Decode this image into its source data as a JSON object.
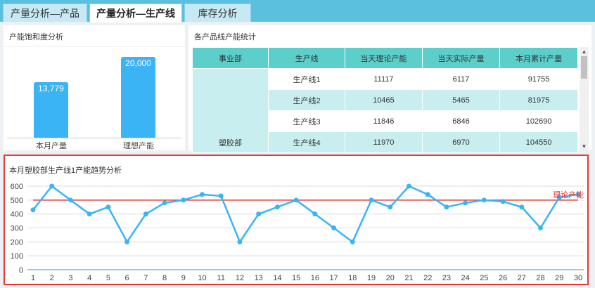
{
  "tabs": [
    {
      "label": "产量分析—产品"
    },
    {
      "label": "产量分析—生产线"
    },
    {
      "label": "库存分析"
    }
  ],
  "capacity": {
    "title": "产能饱和度分析",
    "bars": [
      {
        "label": "本月产量",
        "value": 13779,
        "display": "13,779"
      },
      {
        "label": "理想产能",
        "value": 20000,
        "display": "20,000"
      }
    ]
  },
  "stats": {
    "title": "各产品线产能统计",
    "columns": [
      "事业部",
      "生产线",
      "当天理论产能",
      "当天实际产量",
      "本月累计产量"
    ],
    "dept": "塑胶部",
    "rows": [
      [
        "生产线1",
        "11117",
        "6117",
        "91755"
      ],
      [
        "生产线2",
        "10465",
        "5465",
        "81975"
      ],
      [
        "生产线3",
        "11846",
        "6846",
        "102690"
      ],
      [
        "生产线4",
        "11970",
        "6970",
        "104550"
      ]
    ]
  },
  "trend": {
    "title": "本月塑胶部生产线1产能趋势分析",
    "ref_label": "理论产能",
    "colors": {
      "line": "#3ab4f5",
      "ref": "#e53935"
    },
    "chart_data": {
      "type": "line",
      "x": [
        1,
        2,
        3,
        4,
        5,
        6,
        7,
        8,
        9,
        10,
        11,
        12,
        13,
        14,
        15,
        16,
        17,
        18,
        19,
        20,
        21,
        22,
        23,
        24,
        25,
        26,
        27,
        28,
        29,
        30
      ],
      "series": [
        {
          "values": [
            430,
            600,
            500,
            400,
            450,
            200,
            400,
            480,
            500,
            540,
            530,
            200,
            400,
            450,
            500,
            400,
            300,
            200,
            500,
            450,
            600,
            540,
            450,
            480,
            500,
            490,
            450,
            300,
            520,
            540
          ]
        },
        {
          "name": "理论产能",
          "values": [
            500,
            500,
            500,
            500,
            500,
            500,
            500,
            500,
            500,
            500,
            500,
            500,
            500,
            500,
            500,
            500,
            500,
            500,
            500,
            500,
            500,
            500,
            500,
            500,
            500,
            500,
            500,
            500,
            500,
            500
          ]
        }
      ],
      "yticks": [
        0,
        100,
        200,
        300,
        400,
        500,
        600
      ],
      "ylim": [
        0,
        600
      ],
      "grid": true
    }
  }
}
